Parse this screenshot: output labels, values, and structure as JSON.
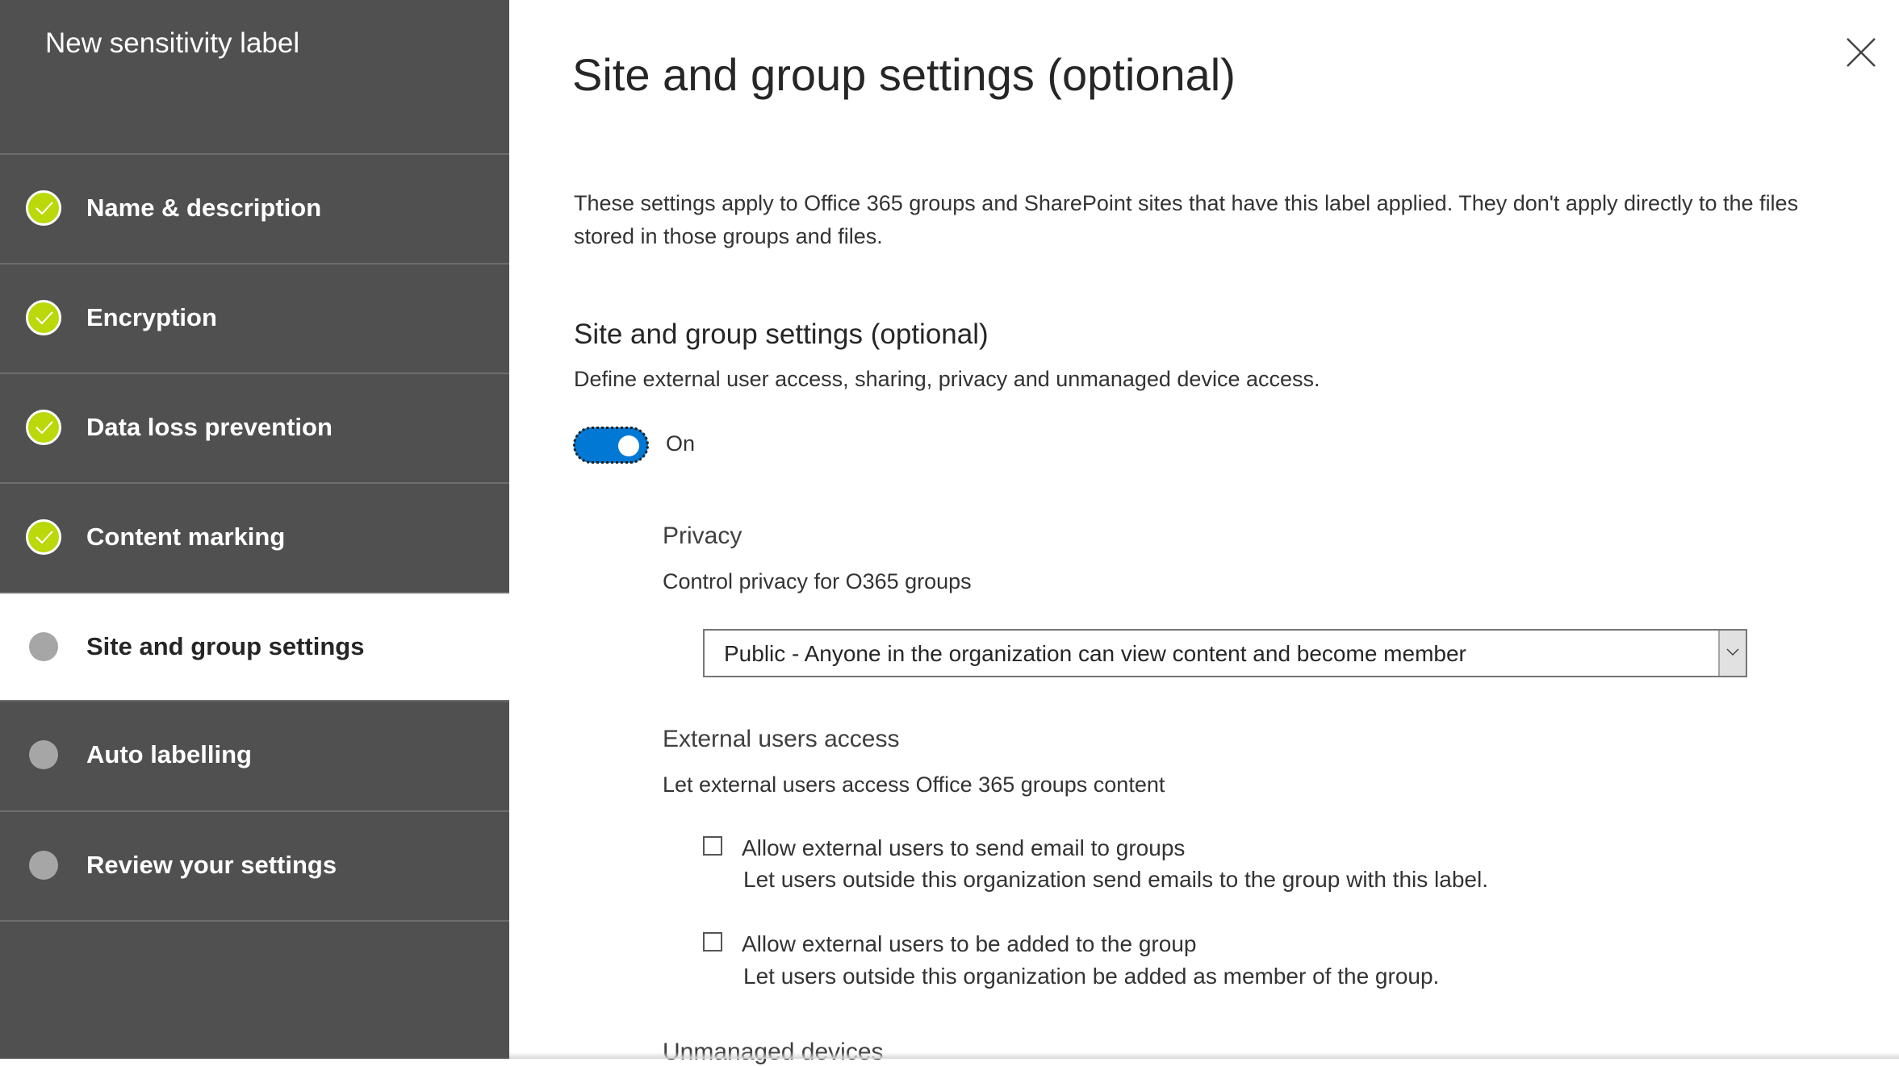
{
  "sidebar": {
    "title": "New sensitivity label",
    "items": [
      {
        "label": "Name & description",
        "status": "done"
      },
      {
        "label": "Encryption",
        "status": "done"
      },
      {
        "label": "Data loss prevention",
        "status": "done"
      },
      {
        "label": "Content marking",
        "status": "done"
      },
      {
        "label": "Site and group settings",
        "status": "current"
      },
      {
        "label": "Auto labelling",
        "status": "pending"
      },
      {
        "label": "Review your settings",
        "status": "pending"
      }
    ]
  },
  "colors": {
    "sidebar_bg": "#505050",
    "done_green": "#bad80a",
    "pending_gray": "#a6a6a6",
    "toggle_blue": "#0078d4"
  },
  "main": {
    "title": "Site and group settings (optional)",
    "close_icon": "close-icon",
    "intro": "These settings apply to Office 365 groups and SharePoint sites that have this label applied. They don't apply directly to the files stored in those groups and files.",
    "section_title": "Site and group settings (optional)",
    "section_desc": "Define external user access, sharing, privacy and unmanaged device access.",
    "toggle": {
      "state": "On",
      "checked": true
    },
    "privacy": {
      "heading": "Privacy",
      "desc": "Control privacy for O365 groups",
      "selected": "Public - Anyone in the organization can view content and become member"
    },
    "external": {
      "heading": "External users access",
      "desc": "Let external users access Office 365 groups content",
      "options": [
        {
          "label": "Allow external users to send email to groups",
          "desc": "Let users outside this organization send emails to the group with this label.",
          "checked": false
        },
        {
          "label": "Allow external users to be added to the group",
          "desc": "Let users outside this organization be added as member of the group.",
          "checked": false
        }
      ]
    },
    "unmanaged_heading": "Unmanaged devices"
  }
}
